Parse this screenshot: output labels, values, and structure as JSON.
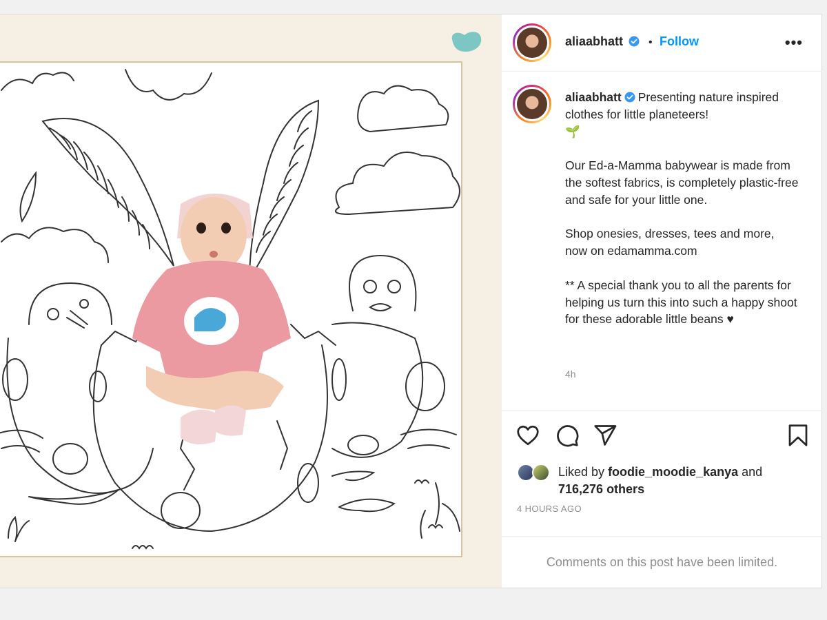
{
  "post": {
    "username": "aliaabhatt",
    "follow_label": "Follow",
    "separator": "•",
    "more_label": "•••",
    "caption": {
      "username": "aliaabhatt",
      "first_line": "Presenting nature inspired clothes for little planeteers!",
      "emoji": "🌱",
      "paragraph_2": "Our Ed-a-Mamma babywear is made from the softest fabrics, is completely plastic-free and safe for your little one.",
      "paragraph_3": "Shop onesies, dresses, tees and more, now on edamamma.com",
      "paragraph_4": "** A special thank you to all the parents for helping us turn this into such a happy shoot for these adorable little beans ♥"
    },
    "relative_time": "4h",
    "likes": {
      "prefix": "Liked by",
      "user": "foodie_moodie_kanya",
      "joiner": "and",
      "count": "716,276 others"
    },
    "timestamp": "4 HOURS AGO",
    "comments_limited": "Comments on this post have been limited."
  },
  "icons": {
    "like": "heart-icon",
    "comment": "comment-icon",
    "share": "send-icon",
    "save": "bookmark-icon",
    "verified": "verified-badge-icon",
    "more": "more-options-icon"
  },
  "colors": {
    "link_blue": "#0095f6",
    "verified_blue": "#3897f0",
    "secondary_text": "#8e8e8e",
    "media_background": "#f6efe4",
    "blob_teal": "#7cc6c4"
  }
}
